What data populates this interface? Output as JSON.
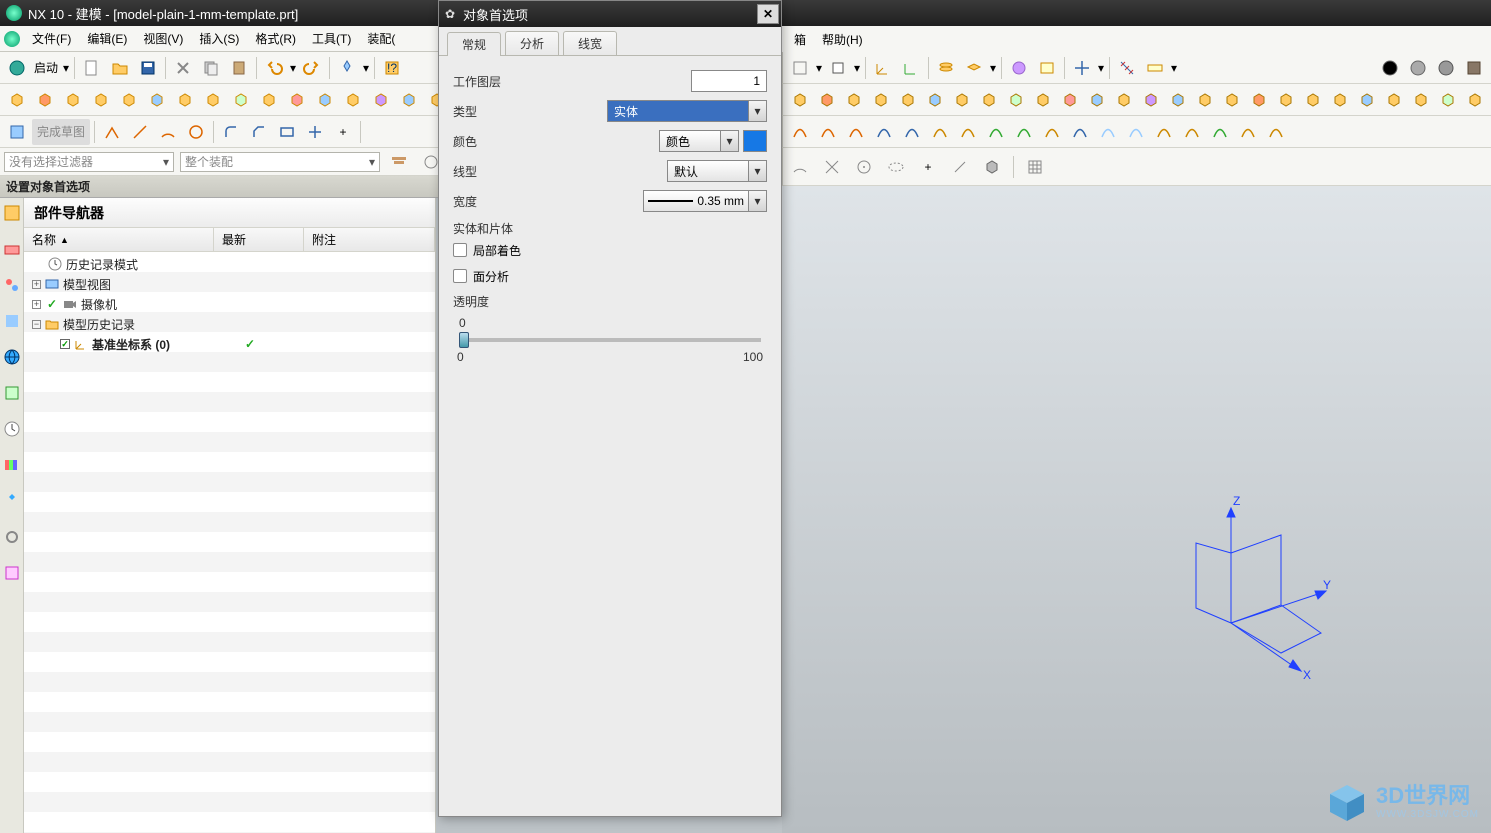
{
  "title": "NX 10 - 建模 - [model-plain-1-mm-template.prt]",
  "menubar": {
    "items": [
      "文件(F)",
      "编辑(E)",
      "视图(V)",
      "插入(S)",
      "格式(R)",
      "工具(T)",
      "装配("
    ],
    "right_items": [
      "箱",
      "帮助(H)"
    ]
  },
  "launch_btn": "启动",
  "filter": {
    "f1": "没有选择过滤器",
    "f2": "整个装配"
  },
  "status": "设置对象首选项",
  "nav": {
    "title": "部件导航器",
    "cols": [
      "名称",
      "最新",
      "附注"
    ],
    "items": [
      {
        "icon": "clock",
        "label": "历史记录模式"
      },
      {
        "exp": "+",
        "icon": "model",
        "label": "模型视图"
      },
      {
        "exp": "+",
        "icon": "camera",
        "label": "摄像机",
        "check": true
      },
      {
        "exp": "-",
        "icon": "folder",
        "label": "模型历史记录"
      },
      {
        "indent": true,
        "checkbox": true,
        "icon": "csys",
        "label": "基准坐标系 (0)",
        "bold": true,
        "rowcheck": true
      }
    ]
  },
  "dialog": {
    "title": "对象首选项",
    "tabs": [
      "常规",
      "分析",
      "线宽"
    ],
    "active_tab": 0,
    "work_layer_label": "工作图层",
    "work_layer_value": "1",
    "type_label": "类型",
    "type_value": "实体",
    "color_label": "颜色",
    "color_combo": "颜色",
    "linetype_label": "线型",
    "linetype_value": "默认",
    "width_label": "宽度",
    "width_value": "0.35 mm",
    "solids_section": "实体和片体",
    "cb1": "局部着色",
    "cb2": "面分析",
    "transp_label": "透明度",
    "slider_top": "0",
    "slider_min": "0",
    "slider_max": "100"
  },
  "coord": {
    "z": "Z",
    "y": "Y",
    "x": "X"
  },
  "watermark": {
    "l1": "3D世界网",
    "l2": "WWW.3DSJW.COM"
  }
}
